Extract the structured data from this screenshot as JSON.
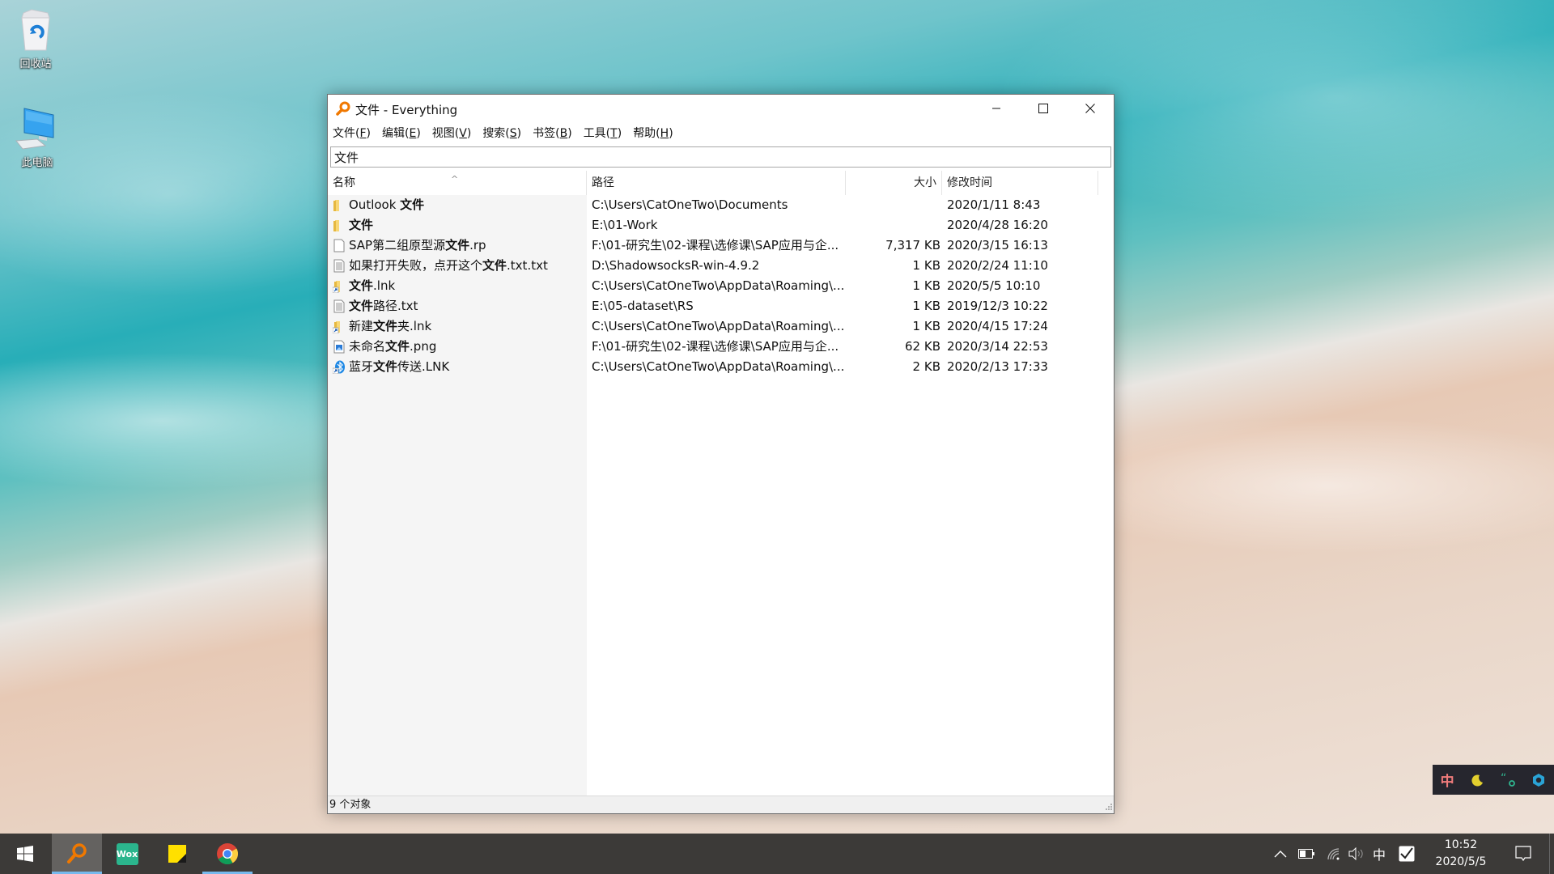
{
  "desktop": {
    "icons": [
      {
        "label": "回收站",
        "icon": "recycle-bin-icon"
      },
      {
        "label": "此电脑",
        "icon": "computer-icon"
      }
    ]
  },
  "window": {
    "title": "文件 - Everything",
    "menu": [
      {
        "label": "文件(",
        "key": "F",
        "end": ")"
      },
      {
        "label": "编辑(",
        "key": "E",
        "end": ")"
      },
      {
        "label": "视图(",
        "key": "V",
        "end": ")"
      },
      {
        "label": "搜索(",
        "key": "S",
        "end": ")"
      },
      {
        "label": "书签(",
        "key": "B",
        "end": ")"
      },
      {
        "label": "工具(",
        "key": "T",
        "end": ")"
      },
      {
        "label": "帮助(",
        "key": "H",
        "end": ")"
      }
    ],
    "search_value": "文件",
    "columns": {
      "name": "名称",
      "path": "路径",
      "size": "大小",
      "modified": "修改时间"
    },
    "sort_indicator": "^",
    "rows": [
      {
        "icon": "folder",
        "name_parts": [
          [
            "Outlook ",
            false
          ],
          [
            "文件",
            true
          ]
        ],
        "path": "C:\\Users\\CatOneTwo\\Documents",
        "size": "",
        "modified": "2020/1/11 8:43"
      },
      {
        "icon": "folder",
        "name_parts": [
          [
            "文件",
            true
          ]
        ],
        "path": "E:\\01-Work",
        "size": "",
        "modified": "2020/4/28 16:20"
      },
      {
        "icon": "blank-file",
        "name_parts": [
          [
            "SAP第二组原型源",
            false
          ],
          [
            "文件",
            true
          ],
          [
            ".rp",
            false
          ]
        ],
        "path": "F:\\01-研究生\\02-课程\\选修课\\SAP应用与企...",
        "size": "7,317 KB",
        "modified": "2020/3/15 16:13"
      },
      {
        "icon": "text-file",
        "name_parts": [
          [
            "如果打开失败，点开这个",
            false
          ],
          [
            "文件",
            true
          ],
          [
            ".txt.txt",
            false
          ]
        ],
        "path": "D:\\ShadowsocksR-win-4.9.2",
        "size": "1 KB",
        "modified": "2020/2/24 11:10"
      },
      {
        "icon": "folder-shortcut",
        "name_parts": [
          [
            "文件",
            true
          ],
          [
            ".lnk",
            false
          ]
        ],
        "path": "C:\\Users\\CatOneTwo\\AppData\\Roaming\\...",
        "size": "1 KB",
        "modified": "2020/5/5 10:10"
      },
      {
        "icon": "text-file",
        "name_parts": [
          [
            "文件",
            true
          ],
          [
            "路径.txt",
            false
          ]
        ],
        "path": "E:\\05-dataset\\RS",
        "size": "1 KB",
        "modified": "2019/12/3 10:22"
      },
      {
        "icon": "folder-shortcut",
        "name_parts": [
          [
            "新建",
            false
          ],
          [
            "文件",
            true
          ],
          [
            "夹.lnk",
            false
          ]
        ],
        "path": "C:\\Users\\CatOneTwo\\AppData\\Roaming\\...",
        "size": "1 KB",
        "modified": "2020/4/15 17:24"
      },
      {
        "icon": "image-file",
        "name_parts": [
          [
            "未命名",
            false
          ],
          [
            "文件",
            true
          ],
          [
            ".png",
            false
          ]
        ],
        "path": "F:\\01-研究生\\02-课程\\选修课\\SAP应用与企...",
        "size": "62 KB",
        "modified": "2020/3/14 22:53"
      },
      {
        "icon": "bluetooth-shortcut",
        "name_parts": [
          [
            "蓝牙",
            false
          ],
          [
            "文件",
            true
          ],
          [
            "传送.LNK",
            false
          ]
        ],
        "path": "C:\\Users\\CatOneTwo\\AppData\\Roaming\\...",
        "size": "2 KB",
        "modified": "2020/2/13 17:33"
      }
    ],
    "status": "9 个对象"
  },
  "ime_toolbar": {
    "mode": "中",
    "colors": {
      "mode": "#f07c7c",
      "moon": "#e2cf2e",
      "quote": "#2fb58f",
      "gear": "#2aa3d6"
    }
  },
  "taskbar": {
    "apps": [
      {
        "name": "Everything",
        "active": true
      },
      {
        "name": "Wox",
        "label": "Wox",
        "active": false
      },
      {
        "name": "Sticky Notes",
        "active": false
      },
      {
        "name": "Chrome",
        "active": false,
        "running": true
      }
    ],
    "tray": {
      "ime": "中"
    },
    "clock": {
      "time": "10:52",
      "date": "2020/5/5"
    }
  },
  "colors": {
    "accent": "#f07800",
    "taskbar_bg": "#3c3a38",
    "running_indicator": "#76b9ed"
  }
}
